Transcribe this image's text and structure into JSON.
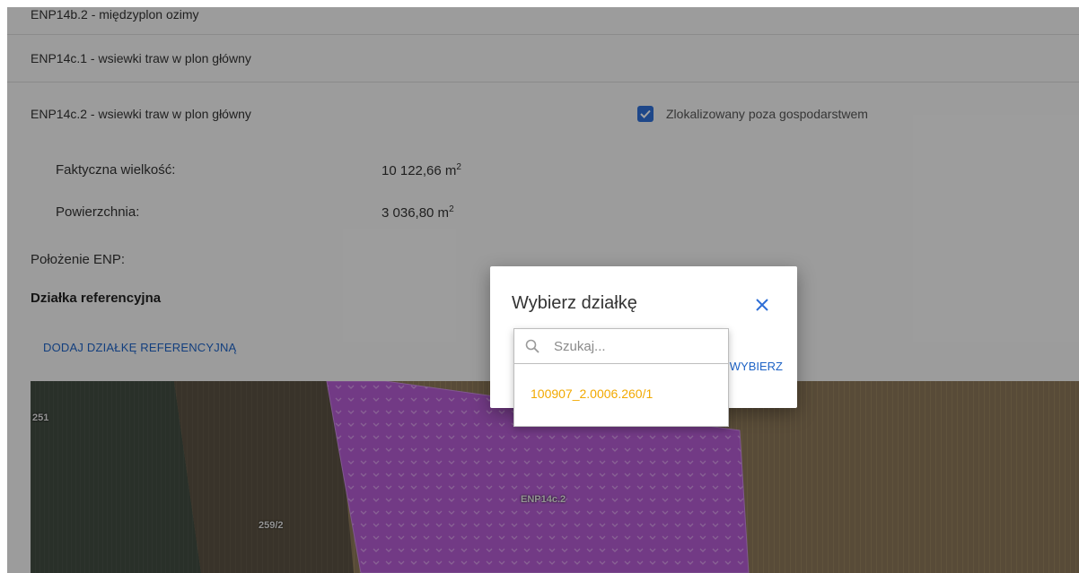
{
  "rows": {
    "row1": "ENP14b.2 - międzyplon ozimy",
    "row2": "ENP14c.1 - wsiewki traw w plon główny",
    "row3": "ENP14c.2 - wsiewki traw w plon główny"
  },
  "checkbox": {
    "label": "Zlokalizowany poza gospodarstwem",
    "checked": true
  },
  "fields": {
    "actual_size_label": "Faktyczna wielkość:",
    "actual_size_value": "10 122,66 m",
    "area_label": "Powierzchnia:",
    "area_value": "3 036,80 m",
    "unit_exp": "2"
  },
  "location_label": "Położenie ENP:",
  "reference_title": "Działka referencyjna",
  "add_reference_link": "DODAJ DZIAŁKĘ REFERENCYJNĄ",
  "map": {
    "labels": {
      "left": "251",
      "middle": "259/2",
      "polygon": "ENP14c.2"
    },
    "colors": {
      "polygon": "#b25bd1",
      "field_dark": "#3d4a3d",
      "field_brown": "#8c7a5f"
    }
  },
  "dialog": {
    "title": "Wybierz działkę",
    "choose_button": "WYBIERZ",
    "search_placeholder": "Szukaj...",
    "options": [
      "100907_2.0006.260/1"
    ]
  },
  "colors": {
    "accent": "#1e63c6",
    "option": "#f2a900"
  }
}
